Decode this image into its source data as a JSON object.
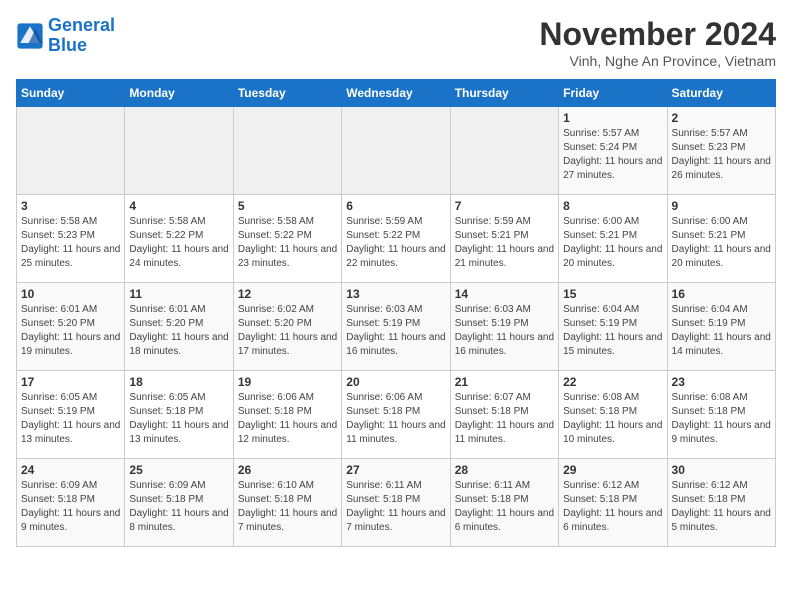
{
  "logo": {
    "line1": "General",
    "line2": "Blue"
  },
  "title": "November 2024",
  "subtitle": "Vinh, Nghe An Province, Vietnam",
  "weekdays": [
    "Sunday",
    "Monday",
    "Tuesday",
    "Wednesday",
    "Thursday",
    "Friday",
    "Saturday"
  ],
  "weeks": [
    [
      {
        "day": "",
        "info": ""
      },
      {
        "day": "",
        "info": ""
      },
      {
        "day": "",
        "info": ""
      },
      {
        "day": "",
        "info": ""
      },
      {
        "day": "",
        "info": ""
      },
      {
        "day": "1",
        "info": "Sunrise: 5:57 AM\nSunset: 5:24 PM\nDaylight: 11 hours and 27 minutes."
      },
      {
        "day": "2",
        "info": "Sunrise: 5:57 AM\nSunset: 5:23 PM\nDaylight: 11 hours and 26 minutes."
      }
    ],
    [
      {
        "day": "3",
        "info": "Sunrise: 5:58 AM\nSunset: 5:23 PM\nDaylight: 11 hours and 25 minutes."
      },
      {
        "day": "4",
        "info": "Sunrise: 5:58 AM\nSunset: 5:22 PM\nDaylight: 11 hours and 24 minutes."
      },
      {
        "day": "5",
        "info": "Sunrise: 5:58 AM\nSunset: 5:22 PM\nDaylight: 11 hours and 23 minutes."
      },
      {
        "day": "6",
        "info": "Sunrise: 5:59 AM\nSunset: 5:22 PM\nDaylight: 11 hours and 22 minutes."
      },
      {
        "day": "7",
        "info": "Sunrise: 5:59 AM\nSunset: 5:21 PM\nDaylight: 11 hours and 21 minutes."
      },
      {
        "day": "8",
        "info": "Sunrise: 6:00 AM\nSunset: 5:21 PM\nDaylight: 11 hours and 20 minutes."
      },
      {
        "day": "9",
        "info": "Sunrise: 6:00 AM\nSunset: 5:21 PM\nDaylight: 11 hours and 20 minutes."
      }
    ],
    [
      {
        "day": "10",
        "info": "Sunrise: 6:01 AM\nSunset: 5:20 PM\nDaylight: 11 hours and 19 minutes."
      },
      {
        "day": "11",
        "info": "Sunrise: 6:01 AM\nSunset: 5:20 PM\nDaylight: 11 hours and 18 minutes."
      },
      {
        "day": "12",
        "info": "Sunrise: 6:02 AM\nSunset: 5:20 PM\nDaylight: 11 hours and 17 minutes."
      },
      {
        "day": "13",
        "info": "Sunrise: 6:03 AM\nSunset: 5:19 PM\nDaylight: 11 hours and 16 minutes."
      },
      {
        "day": "14",
        "info": "Sunrise: 6:03 AM\nSunset: 5:19 PM\nDaylight: 11 hours and 16 minutes."
      },
      {
        "day": "15",
        "info": "Sunrise: 6:04 AM\nSunset: 5:19 PM\nDaylight: 11 hours and 15 minutes."
      },
      {
        "day": "16",
        "info": "Sunrise: 6:04 AM\nSunset: 5:19 PM\nDaylight: 11 hours and 14 minutes."
      }
    ],
    [
      {
        "day": "17",
        "info": "Sunrise: 6:05 AM\nSunset: 5:19 PM\nDaylight: 11 hours and 13 minutes."
      },
      {
        "day": "18",
        "info": "Sunrise: 6:05 AM\nSunset: 5:18 PM\nDaylight: 11 hours and 13 minutes."
      },
      {
        "day": "19",
        "info": "Sunrise: 6:06 AM\nSunset: 5:18 PM\nDaylight: 11 hours and 12 minutes."
      },
      {
        "day": "20",
        "info": "Sunrise: 6:06 AM\nSunset: 5:18 PM\nDaylight: 11 hours and 11 minutes."
      },
      {
        "day": "21",
        "info": "Sunrise: 6:07 AM\nSunset: 5:18 PM\nDaylight: 11 hours and 11 minutes."
      },
      {
        "day": "22",
        "info": "Sunrise: 6:08 AM\nSunset: 5:18 PM\nDaylight: 11 hours and 10 minutes."
      },
      {
        "day": "23",
        "info": "Sunrise: 6:08 AM\nSunset: 5:18 PM\nDaylight: 11 hours and 9 minutes."
      }
    ],
    [
      {
        "day": "24",
        "info": "Sunrise: 6:09 AM\nSunset: 5:18 PM\nDaylight: 11 hours and 9 minutes."
      },
      {
        "day": "25",
        "info": "Sunrise: 6:09 AM\nSunset: 5:18 PM\nDaylight: 11 hours and 8 minutes."
      },
      {
        "day": "26",
        "info": "Sunrise: 6:10 AM\nSunset: 5:18 PM\nDaylight: 11 hours and 7 minutes."
      },
      {
        "day": "27",
        "info": "Sunrise: 6:11 AM\nSunset: 5:18 PM\nDaylight: 11 hours and 7 minutes."
      },
      {
        "day": "28",
        "info": "Sunrise: 6:11 AM\nSunset: 5:18 PM\nDaylight: 11 hours and 6 minutes."
      },
      {
        "day": "29",
        "info": "Sunrise: 6:12 AM\nSunset: 5:18 PM\nDaylight: 11 hours and 6 minutes."
      },
      {
        "day": "30",
        "info": "Sunrise: 6:12 AM\nSunset: 5:18 PM\nDaylight: 11 hours and 5 minutes."
      }
    ]
  ]
}
